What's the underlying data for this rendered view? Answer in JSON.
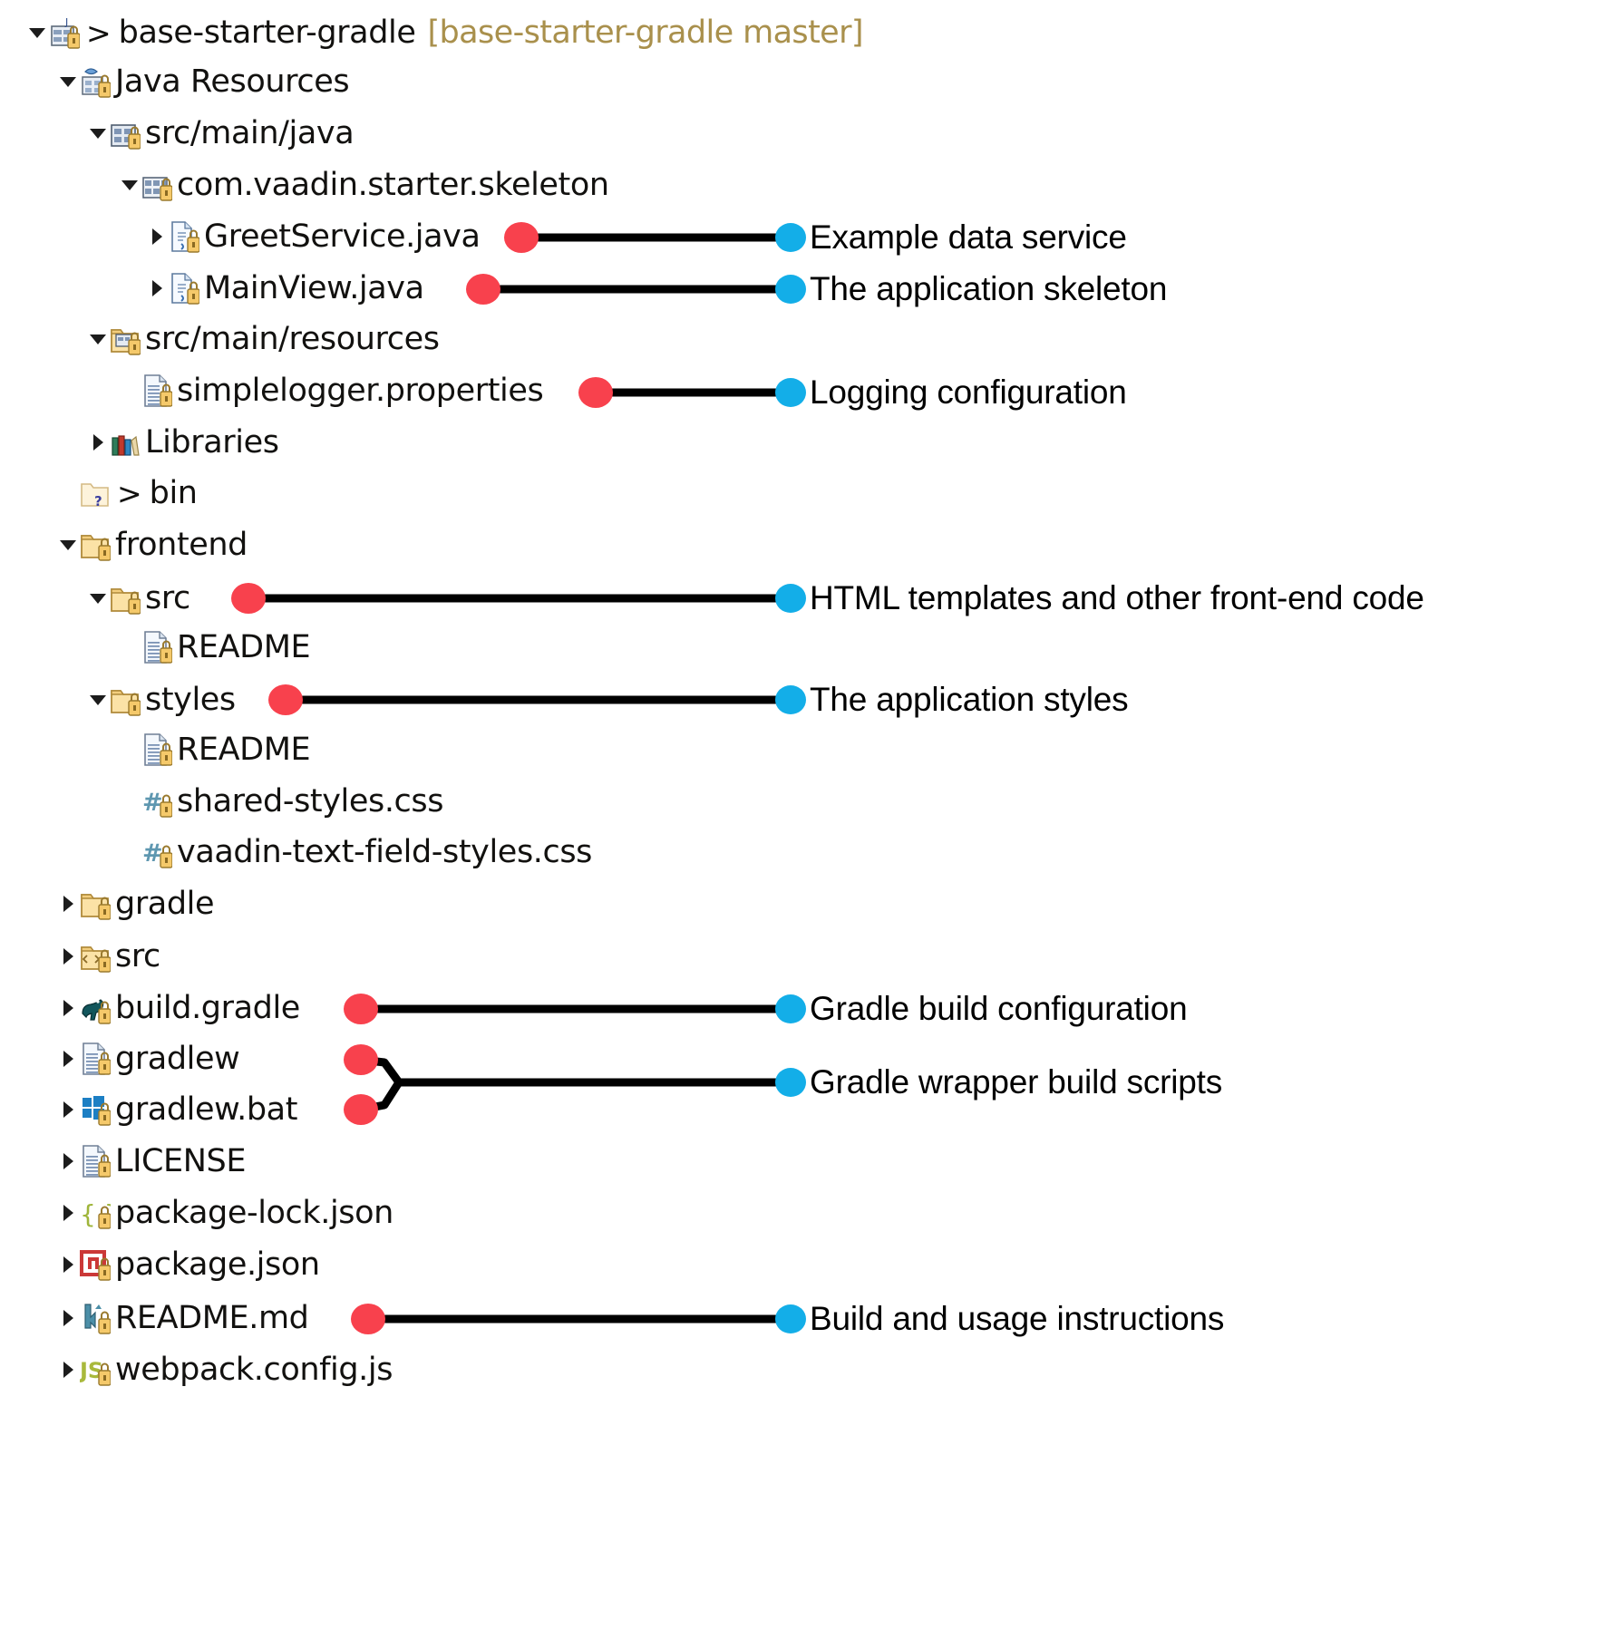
{
  "colors": {
    "source_dot": "#F8414D",
    "target_dot": "#13AEE8",
    "connector": "#000000",
    "text": "#12110f",
    "git_branch_text": "#a9904c",
    "background": "#ffffff"
  },
  "tree": {
    "root_label": "base-starter-gradle",
    "root_git_branch": "[base-starter-gradle master]",
    "separator": ">",
    "items": [
      {
        "label": "base-starter-gradle",
        "git": "[base-starter-gradle master]",
        "icon": "java-project-icon",
        "twisty": "down",
        "depth": 0,
        "sep": ">"
      },
      {
        "label": "Java Resources",
        "icon": "java-resources-icon",
        "twisty": "down",
        "depth": 1
      },
      {
        "label": "src/main/java",
        "icon": "source-folder-icon",
        "twisty": "down",
        "depth": 2
      },
      {
        "label": "com.vaadin.starter.skeleton",
        "icon": "package-icon",
        "twisty": "down",
        "depth": 3
      },
      {
        "label": "GreetService.java",
        "icon": "java-file-icon",
        "twisty": "right",
        "depth": 4
      },
      {
        "label": "MainView.java",
        "icon": "java-file-icon",
        "twisty": "right",
        "depth": 4
      },
      {
        "label": "src/main/resources",
        "icon": "resource-folder-icon",
        "twisty": "down",
        "depth": 2
      },
      {
        "label": "simplelogger.properties",
        "icon": "text-file-icon",
        "twisty": "none",
        "depth": 3
      },
      {
        "label": "Libraries",
        "icon": "libraries-icon",
        "twisty": "right",
        "depth": 2
      },
      {
        "label": "bin",
        "icon": "hidden-folder-icon",
        "twisty": "none",
        "depth": 1,
        "sep": ">"
      },
      {
        "label": "frontend",
        "icon": "folder-icon",
        "twisty": "down",
        "depth": 1
      },
      {
        "label": "src",
        "icon": "folder-icon",
        "twisty": "down",
        "depth": 2
      },
      {
        "label": "README",
        "icon": "text-file-icon",
        "twisty": "none",
        "depth": 3
      },
      {
        "label": "styles",
        "icon": "folder-icon",
        "twisty": "down",
        "depth": 2
      },
      {
        "label": "README",
        "icon": "text-file-icon",
        "twisty": "none",
        "depth": 3
      },
      {
        "label": "shared-styles.css",
        "icon": "css-file-icon",
        "twisty": "none",
        "depth": 3
      },
      {
        "label": "vaadin-text-field-styles.css",
        "icon": "css-file-icon",
        "twisty": "none",
        "depth": 3
      },
      {
        "label": "gradle",
        "icon": "folder-icon",
        "twisty": "right",
        "depth": 1
      },
      {
        "label": "src",
        "icon": "source-folder2-icon",
        "twisty": "right",
        "depth": 1
      },
      {
        "label": "build.gradle",
        "icon": "gradle-file-icon",
        "twisty": "right",
        "depth": 1
      },
      {
        "label": "gradlew",
        "icon": "text-file-icon",
        "twisty": "right",
        "depth": 1
      },
      {
        "label": "gradlew.bat",
        "icon": "bat-file-icon",
        "twisty": "right",
        "depth": 1
      },
      {
        "label": "LICENSE",
        "icon": "text-file-icon",
        "twisty": "right",
        "depth": 1
      },
      {
        "label": "package-lock.json",
        "icon": "json-file-icon",
        "twisty": "right",
        "depth": 1
      },
      {
        "label": "package.json",
        "icon": "npm-file-icon",
        "twisty": "right",
        "depth": 1
      },
      {
        "label": "README.md",
        "icon": "markdown-file-icon",
        "twisty": "right",
        "depth": 1
      },
      {
        "label": "webpack.config.js",
        "icon": "js-file-icon",
        "twisty": "right",
        "depth": 1
      }
    ]
  },
  "annotations": [
    {
      "text": "Example data service",
      "target": "GreetService.java"
    },
    {
      "text": "The application skeleton",
      "target": "MainView.java"
    },
    {
      "text": "Logging configuration",
      "target": "simplelogger.properties"
    },
    {
      "text": "HTML templates and other front-end code",
      "target": "frontend/src"
    },
    {
      "text": "The application styles",
      "target": "frontend/styles"
    },
    {
      "text": "Gradle build configuration",
      "target": "build.gradle"
    },
    {
      "text": "Gradle wrapper build scripts",
      "target": "gradlew + gradlew.bat"
    },
    {
      "text": "Build and usage instructions",
      "target": "README.md"
    }
  ]
}
